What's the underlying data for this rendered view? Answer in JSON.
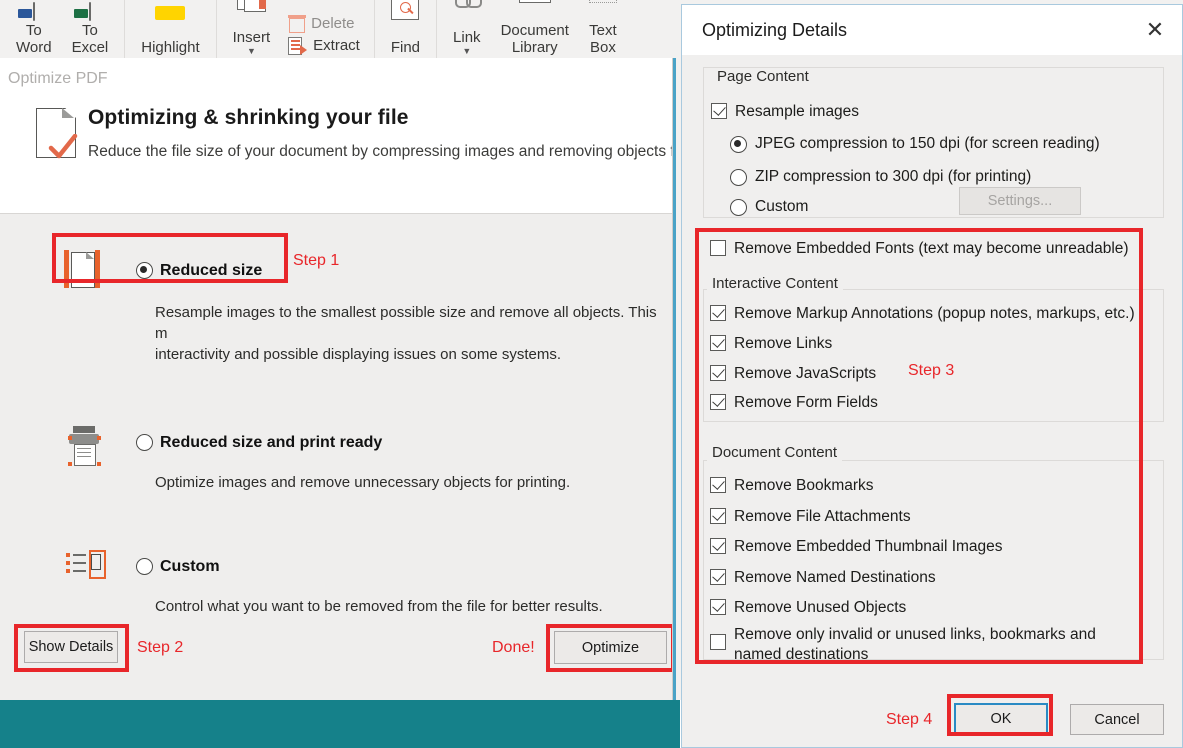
{
  "ribbon": {
    "groups": [
      {
        "name": "convert",
        "buttons": [
          {
            "label": "To\nWord",
            "icon": "to-word-icon"
          },
          {
            "label": "To\nExcel",
            "icon": "to-excel-icon"
          }
        ]
      },
      {
        "name": "highlight",
        "buttons": [
          {
            "label": "Highlight",
            "icon": "highlight-icon"
          }
        ]
      },
      {
        "name": "pages",
        "buttons": [
          {
            "label": "Insert",
            "icon": "insert-pages-icon",
            "has_caret": true
          }
        ],
        "small_buttons": [
          {
            "label": "Delete",
            "icon": "trash-icon",
            "disabled": true
          },
          {
            "label": "Extract",
            "icon": "extract-icon",
            "disabled": false
          }
        ]
      },
      {
        "name": "find",
        "buttons": [
          {
            "label": "Find",
            "icon": "find-icon"
          }
        ]
      },
      {
        "name": "insert-objects",
        "buttons": [
          {
            "label": "Link",
            "icon": "link-icon",
            "has_caret": true
          },
          {
            "label": "Document\nLibrary",
            "icon": "document-library-icon"
          },
          {
            "label": "Text\nBox",
            "icon": "text-box-icon"
          }
        ]
      }
    ]
  },
  "optimize_pane": {
    "breadcrumb": "Optimize PDF",
    "header_title": "Optimizing & shrinking your file",
    "header_subtitle": "Reduce the file size of your document by compressing images and removing objects fro",
    "options": [
      {
        "id": "reduced-size",
        "label": "Reduced size",
        "selected": true,
        "description": "Resample images to the smallest possible size and remove all objects. This m\ninteractivity and possible displaying issues on some systems.",
        "icon": "compress-document-icon"
      },
      {
        "id": "reduced-size-print-ready",
        "label": "Reduced size and print ready",
        "selected": false,
        "description": "Optimize images and remove unnecessary objects for printing.",
        "icon": "printer-icon"
      },
      {
        "id": "custom",
        "label": "Custom",
        "selected": false,
        "description": "Control what you want to be removed from the file for better results.",
        "icon": "custom-list-icon"
      }
    ],
    "show_details_button": "Show Details",
    "optimize_button": "Optimize",
    "annotations": {
      "step1": "Step 1",
      "step2": "Step 2",
      "done": "Done!"
    }
  },
  "dialog": {
    "title": "Optimizing Details",
    "close_icon": "close-icon",
    "groups": {
      "page_content": {
        "legend": "Page Content",
        "resample_images": {
          "label": "Resample images",
          "checked": true
        },
        "radios": [
          {
            "label": "JPEG compression to 150 dpi (for screen reading)",
            "selected": true
          },
          {
            "label": "ZIP compression to 300 dpi (for printing)",
            "selected": false
          },
          {
            "label": "Custom",
            "selected": false
          }
        ],
        "settings_button": {
          "label": "Settings...",
          "disabled": true
        },
        "remove_embedded_fonts": {
          "label": "Remove Embedded Fonts (text may become unreadable)",
          "checked": false
        }
      },
      "interactive_content": {
        "legend": "Interactive Content",
        "items": [
          {
            "label": "Remove Markup Annotations (popup notes, markups, etc.)",
            "checked": true
          },
          {
            "label": "Remove Links",
            "checked": true
          },
          {
            "label": "Remove JavaScripts",
            "checked": true
          },
          {
            "label": "Remove Form Fields",
            "checked": true
          }
        ]
      },
      "document_content": {
        "legend": "Document Content",
        "items": [
          {
            "label": "Remove Bookmarks",
            "checked": true
          },
          {
            "label": "Remove File Attachments",
            "checked": true
          },
          {
            "label": "Remove Embedded Thumbnail Images",
            "checked": true
          },
          {
            "label": "Remove Named Destinations",
            "checked": true
          },
          {
            "label": "Remove Unused Objects",
            "checked": true
          },
          {
            "label": "Remove only invalid or unused links, bookmarks and\nnamed destinations",
            "checked": false
          }
        ]
      }
    },
    "footer": {
      "step4": "Step 4",
      "ok_button": "OK",
      "cancel_button": "Cancel"
    },
    "annotations": {
      "step3": "Step 3"
    }
  },
  "colors": {
    "callout_red": "#e8262a",
    "teal_footer": "#15818a",
    "accent_blue": "#2a8ac4",
    "dialog_bg": "#f0efee"
  }
}
